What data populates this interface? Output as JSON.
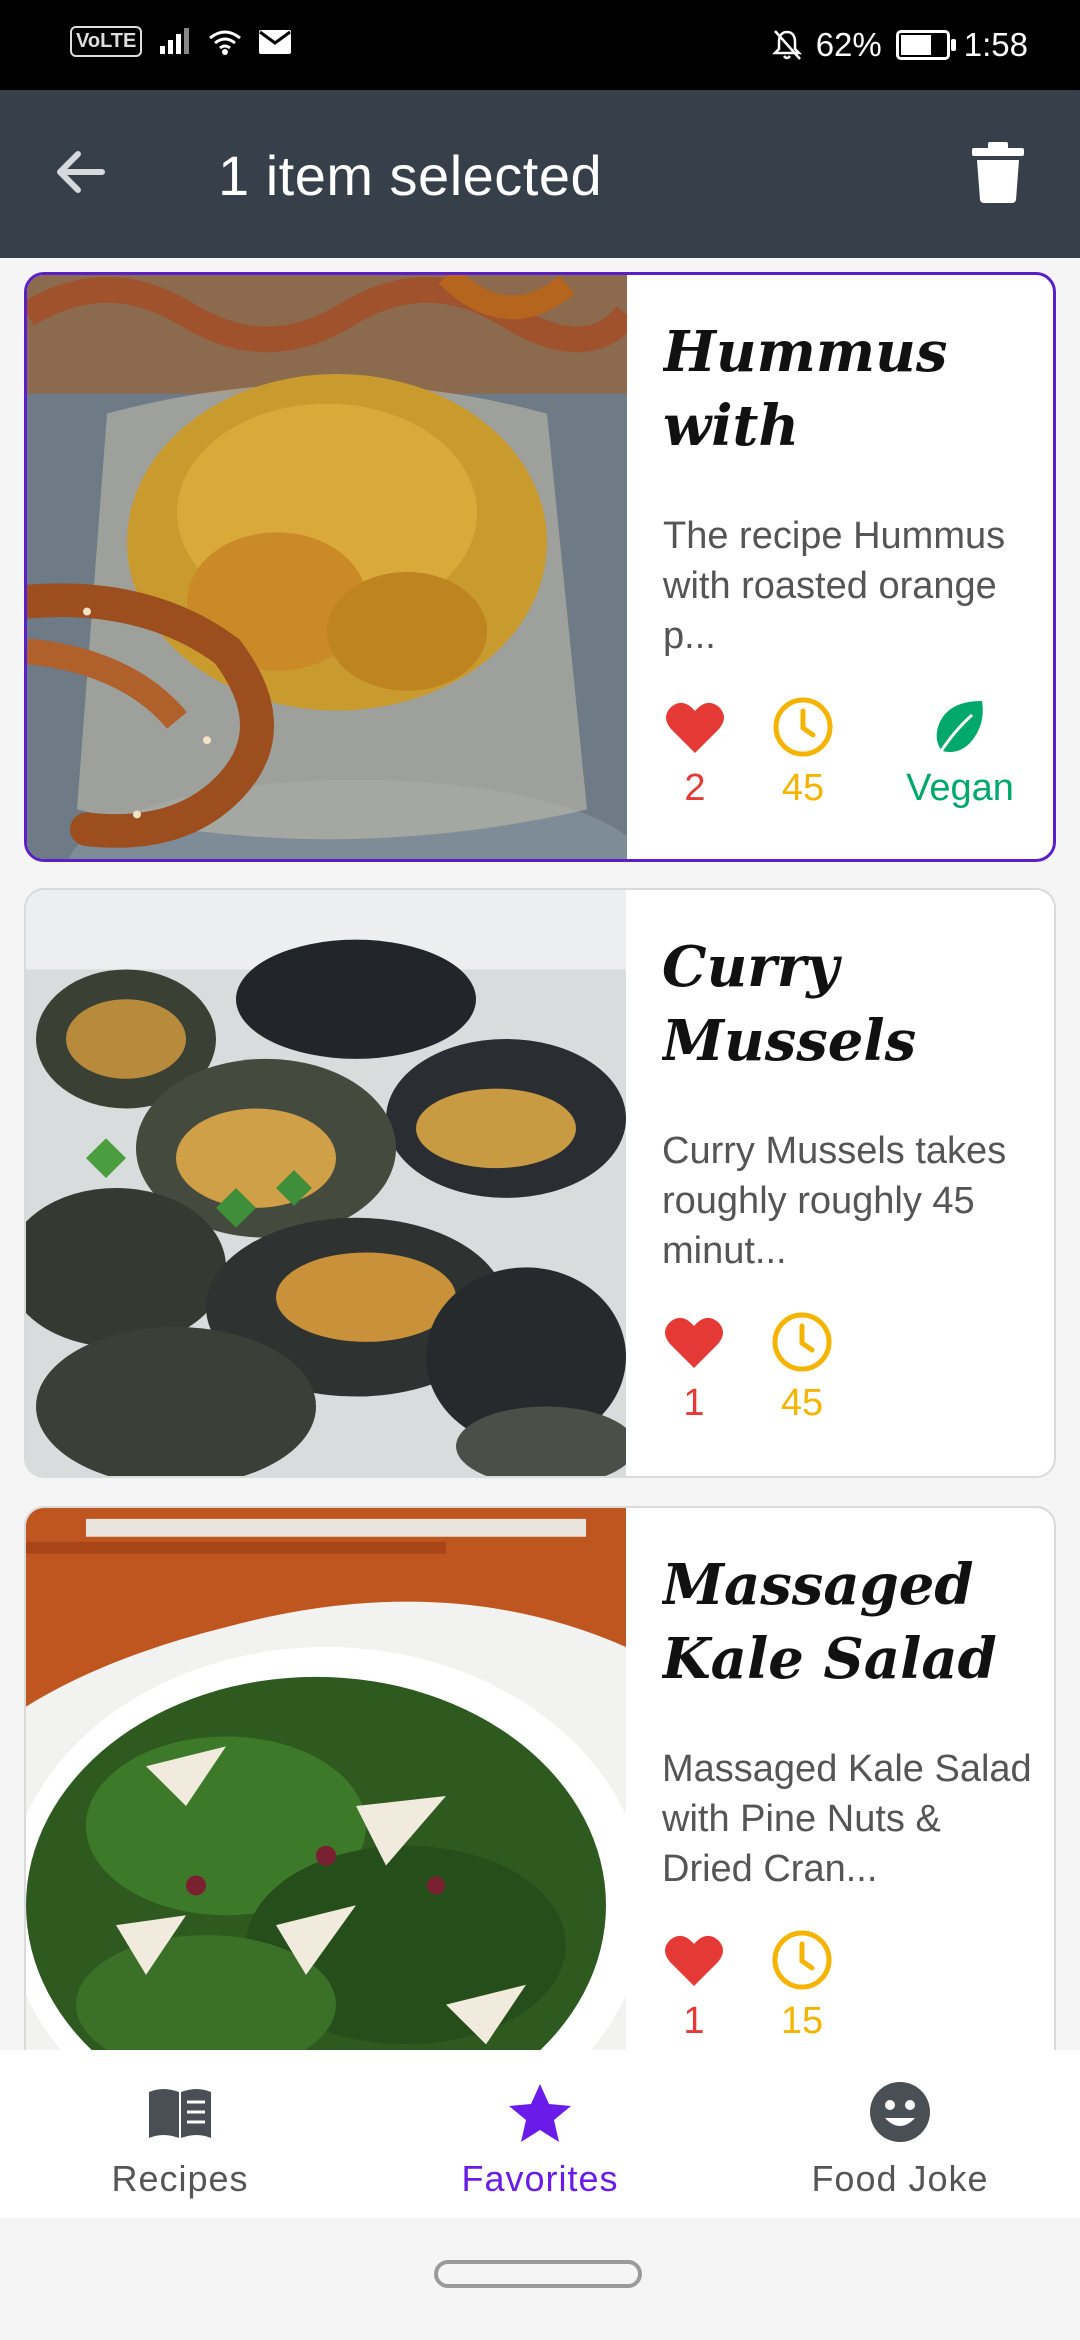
{
  "status_bar": {
    "volte": "VoLTE",
    "battery": "62%",
    "time": "1:58",
    "battery_level": 0.62
  },
  "toolbar": {
    "title": "1 item selected"
  },
  "recipes": [
    {
      "title": "Hummus with roaste...",
      "description": "The recipe Hummus with roasted orange p...",
      "likes": "2",
      "minutes": "45",
      "vegan_label": "Vegan",
      "selected": true
    },
    {
      "title": "Curry Mussels",
      "description": "Curry Mussels takes roughly roughly 45 minut...",
      "likes": "1",
      "minutes": "45",
      "selected": false
    },
    {
      "title": "Massaged Kale Salad ...",
      "description": "Massaged Kale Salad with Pine Nuts & Dried Cran...",
      "likes": "1",
      "minutes": "15",
      "selected": false
    }
  ],
  "bottom_nav": {
    "items": [
      {
        "label": "Recipes",
        "icon": "book-icon"
      },
      {
        "label": "Favorites",
        "icon": "star-icon",
        "active": true
      },
      {
        "label": "Food Joke",
        "icon": "smiley-icon"
      }
    ]
  },
  "colors": {
    "accent": "#6A1BEA",
    "heart": "#E53935",
    "time": "#F4B400",
    "vegan": "#00A86B",
    "toolbar": "#37404A"
  }
}
